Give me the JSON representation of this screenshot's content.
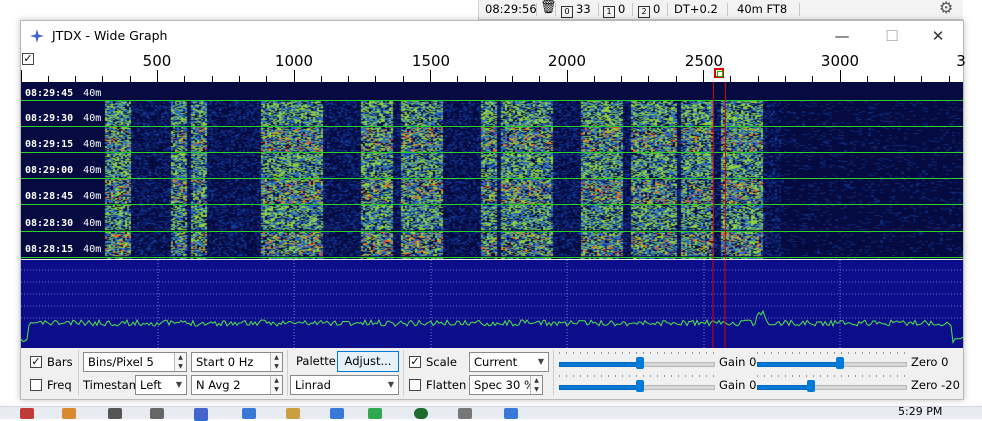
{
  "status_bar": {
    "time": "08:29:56",
    "trash_icon": "trash-icon",
    "count_0_label": "0",
    "count_0_value": "33",
    "count_1_label": "1",
    "count_1_value": "0",
    "count_2_label": "2",
    "count_2_value": "0",
    "dt": "DT+0.2",
    "mode": "40m FT8",
    "settings_icon": "gear-icon"
  },
  "window": {
    "title": "JTDX - Wide Graph",
    "app_icon": "jtdx-star-icon",
    "minimize": "—",
    "maximize": "☐",
    "close": "✕"
  },
  "scale": {
    "checkbox": "✓",
    "labels": [
      "500",
      "1000",
      "1500",
      "2000",
      "2500",
      "3000",
      "3"
    ],
    "marker_color_rx": "#00c000",
    "marker_color_tx": "#e00000"
  },
  "waterfall": {
    "band_label": "40m",
    "timestamps": [
      "08:29:45",
      "08:29:30",
      "08:29:15",
      "08:29:00",
      "08:28:45",
      "08:28:30",
      "08:28:15"
    ],
    "colors": {
      "background": "#050a40",
      "separator": "#2bd22b",
      "signal_hot": "#ff5a1a",
      "signal_mid": "#8fd13a"
    }
  },
  "spectrum": {
    "colors": {
      "background": "#0c0d8a",
      "trace": "#4ce84c"
    }
  },
  "controls": {
    "bars_label": "Bars",
    "bars_checked": "✓",
    "freq_label": "Freq",
    "bins_per_pixel": "Bins/Pixel  5",
    "timestamp_label": "Timestamp",
    "timestamp_value": "Left",
    "start": "Start 0 Hz",
    "navg": "N Avg 2",
    "palette_label": "Palette",
    "adjust_button": "Adjust...",
    "palette_value": "Linrad",
    "scale_label": "Scale",
    "scale_checked": "✓",
    "flatten_label": "Flatten",
    "current_value": "Current",
    "spec_value": "Spec 30 %",
    "gain_label_1a": "Gain 0",
    "gain_label_2a": "Gain 0",
    "zero_label_1": "Zero 0",
    "zero_label_2": "Zero -20",
    "slider_levels": {
      "s1": 0.52,
      "s2": 0.52,
      "s3": 0.55,
      "s4": 0.36
    }
  },
  "taskbar": {
    "clock": "5:29 PM"
  }
}
